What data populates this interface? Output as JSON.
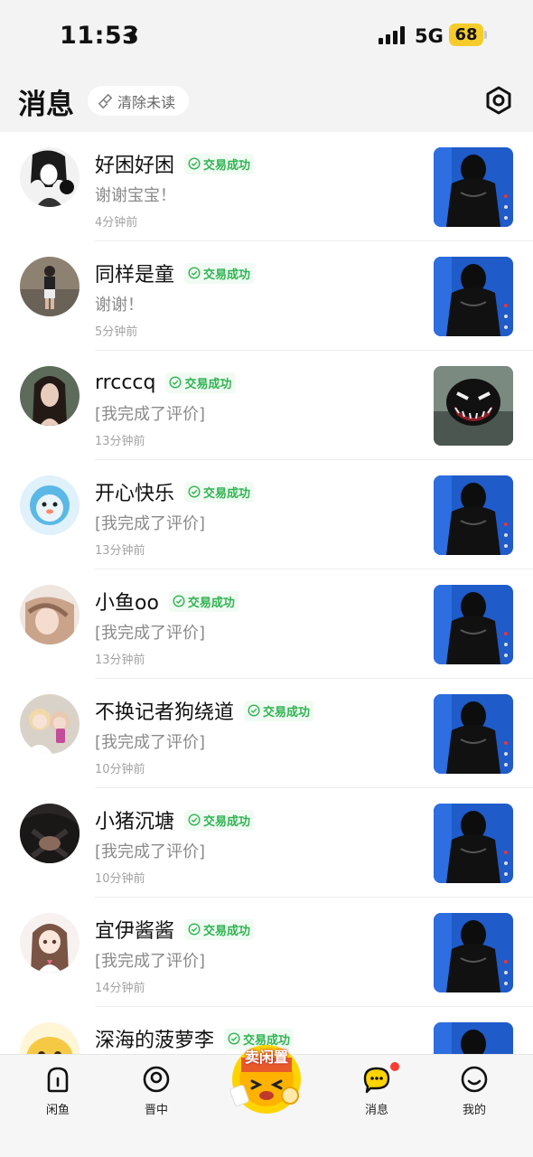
{
  "status_bar": {
    "time": "11:53",
    "network": "5G",
    "battery": "68"
  },
  "header": {
    "title": "消息",
    "clear_unread": "清除未读"
  },
  "badge_label": "交易成功",
  "messages": [
    {
      "name": "好困好困",
      "preview": "谢谢宝宝！",
      "time": "4分钟前"
    },
    {
      "name": "同样是童",
      "preview": "谢谢！",
      "time": "5分钟前"
    },
    {
      "name": "rrcccq",
      "preview": "[我完成了评价]",
      "time": "13分钟前"
    },
    {
      "name": "开心快乐",
      "preview": "[我完成了评价]",
      "time": "13分钟前"
    },
    {
      "name": "小鱼oo",
      "preview": "[我完成了评价]",
      "time": "13分钟前"
    },
    {
      "name": "不换记者狗绕道",
      "preview": "[我完成了评价]",
      "time": "10分钟前"
    },
    {
      "name": "小猪沉塘",
      "preview": "[我完成了评价]",
      "time": "10分钟前"
    },
    {
      "name": "宜伊酱酱",
      "preview": "[我完成了评价]",
      "time": "14分钟前"
    },
    {
      "name": "深海的菠萝李",
      "preview": "",
      "time": ""
    }
  ],
  "tab_bar": {
    "home": "闲鱼",
    "discover": "晋中",
    "sell": "卖闲置",
    "messages": "消息",
    "me": "我的"
  },
  "colors": {
    "accent_green": "#2fb451",
    "brand_yellow": "#ffd400",
    "unread_red": "#ff3b30"
  }
}
